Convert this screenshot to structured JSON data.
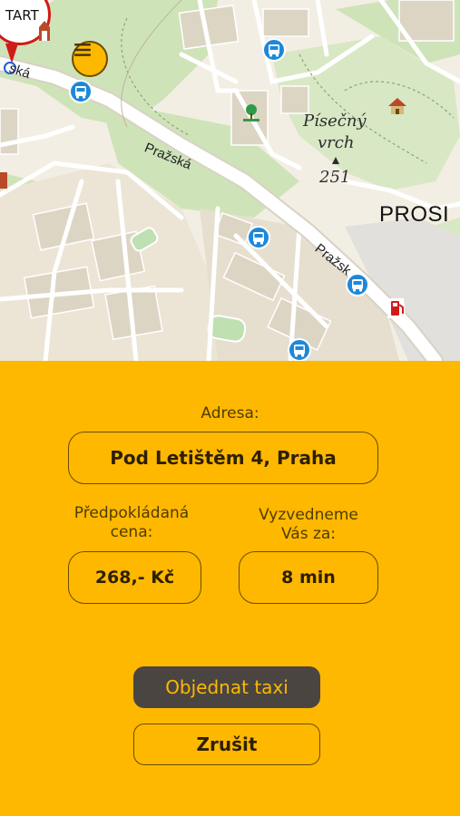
{
  "map": {
    "start_label": "TART",
    "peak_name": "Písečný",
    "peak_name2": "vrch",
    "peak_elevation": "251",
    "district_label": "PROSI",
    "road_labels": [
      "ská",
      "Pražská",
      "Pražsk"
    ]
  },
  "form": {
    "address_label": "Adresa:",
    "address_value": "Pod Letištěm 4, Praha",
    "price_label_line1": "Předpokládaná",
    "price_label_line2": "cena:",
    "price_value": "268,- Kč",
    "pickup_label_line1": "Vyzvedneme",
    "pickup_label_line2": "Vás za:",
    "pickup_value": "8 min"
  },
  "actions": {
    "order_label": "Objednat taxi",
    "cancel_label": "Zrušit"
  },
  "colors": {
    "accent": "#ffb800",
    "dark_button": "#4a4540",
    "pin_red": "#d11a1a",
    "bus_blue": "#1e88d8"
  },
  "icons": [
    "menu-icon",
    "bus-stop-icon",
    "fuel-station-icon",
    "tree-icon",
    "monument-icon",
    "peak-icon"
  ]
}
